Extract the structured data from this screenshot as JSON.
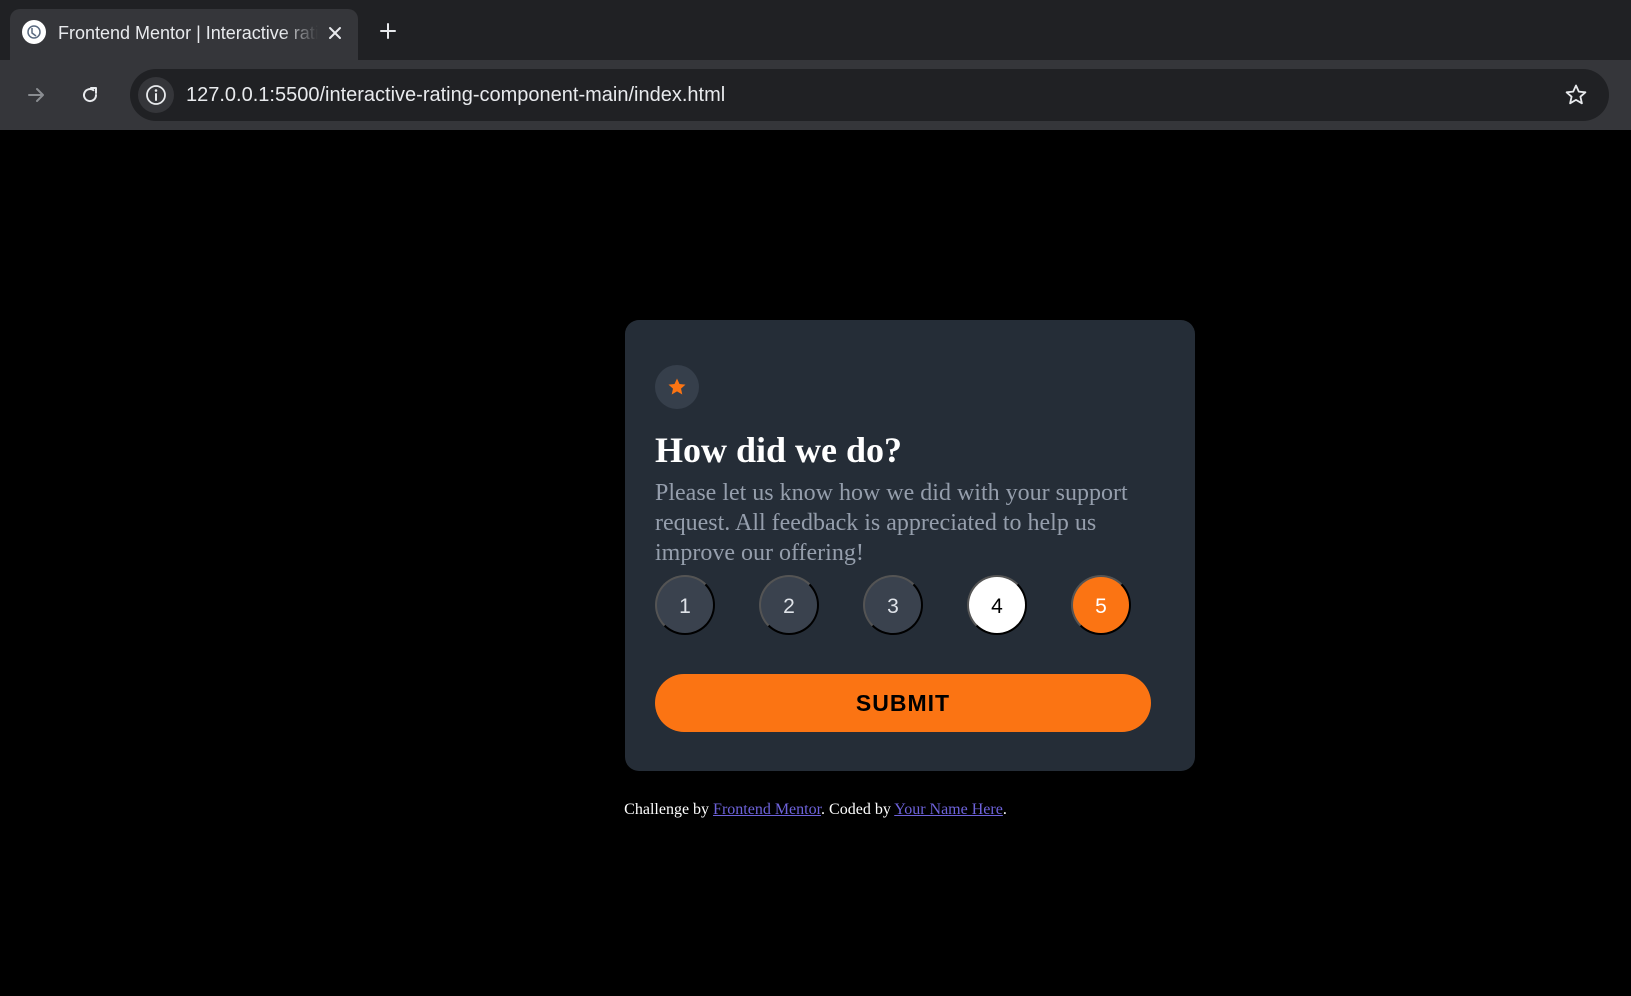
{
  "browser": {
    "tab": {
      "title": "Frontend Mentor | Interactive rating component"
    },
    "url": "127.0.0.1:5500/interactive-rating-component-main/index.html"
  },
  "card": {
    "icon": "star-icon",
    "title": "How did we do?",
    "description": "Please let us know how we did with your support request. All feedback is appreciated to help us improve our offering!",
    "ratings": [
      "1",
      "2",
      "3",
      "4",
      "5"
    ],
    "hovered_rating": "4",
    "selected_rating": "5",
    "submit_label": "SUBMIT"
  },
  "attribution": {
    "prefix": "Challenge by",
    "link1": "Frontend Mentor",
    "middle": ". Coded by",
    "link2": "Your Name Here",
    "suffix": "."
  },
  "colors": {
    "accent": "#fb7413",
    "card_bg": "#252d37",
    "page_bg": "#000000",
    "link": "#6e63db"
  }
}
